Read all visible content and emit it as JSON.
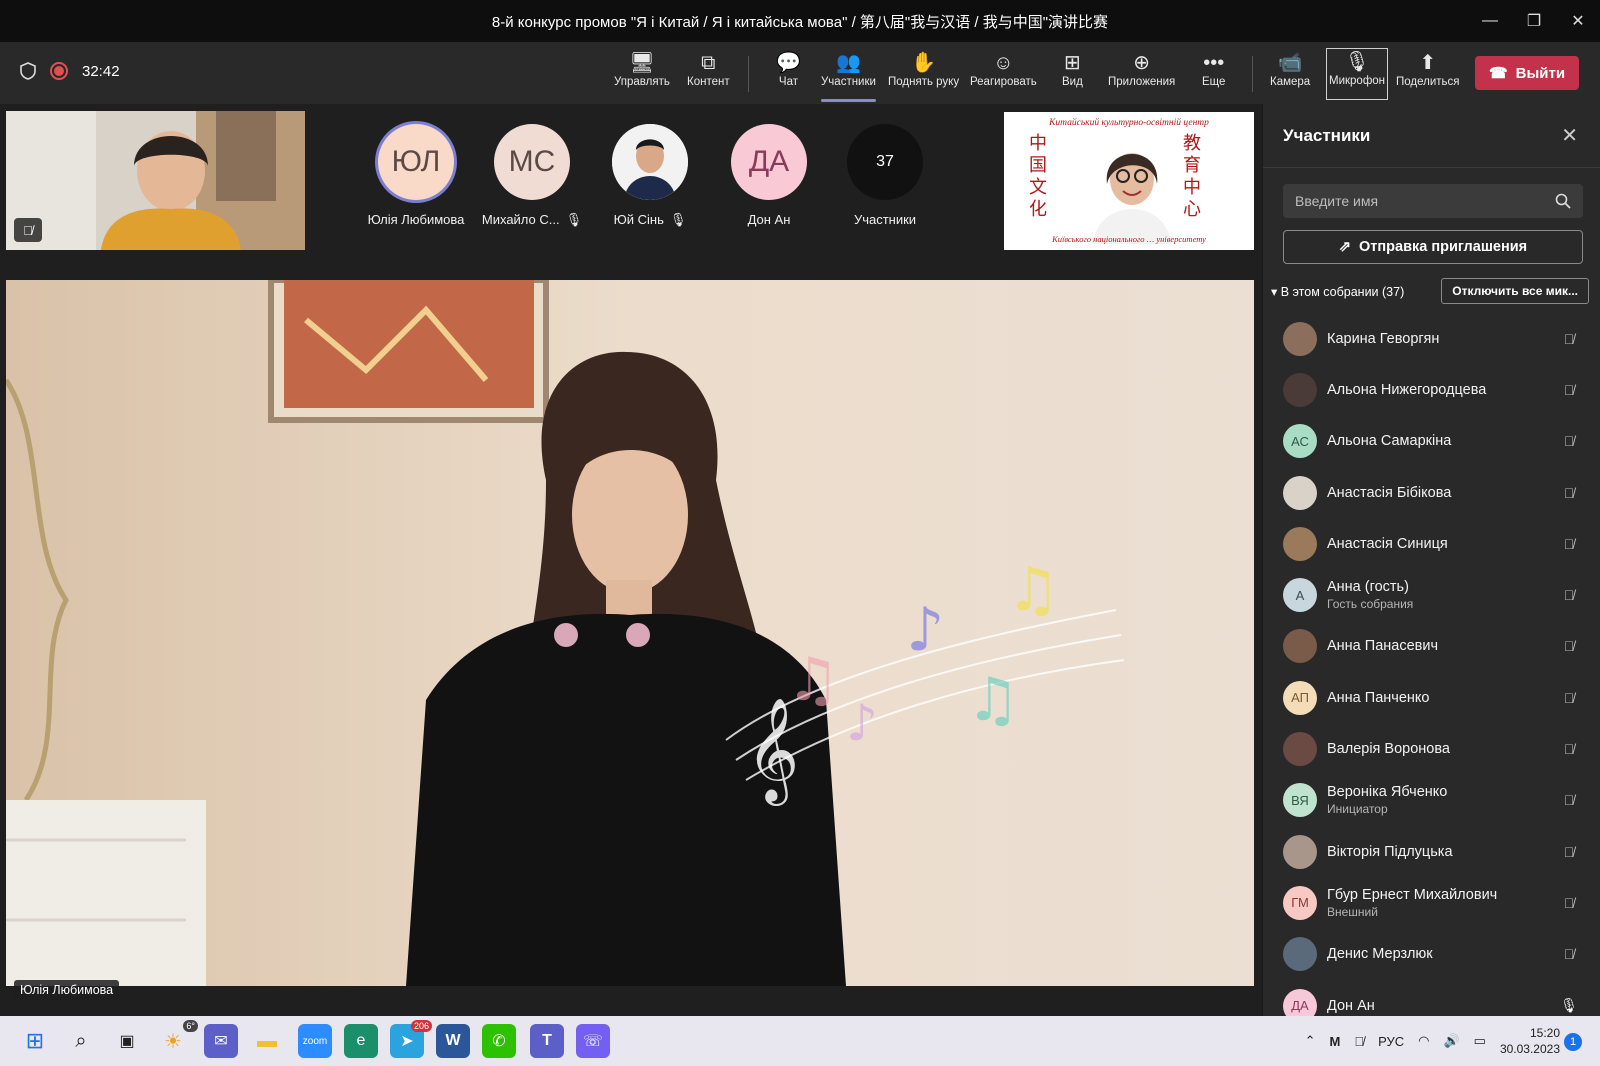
{
  "window": {
    "title": "8-й конкурс промов \"Я і Китай / Я і китайська мова\" / 第八届\"我与汉语 / 我与中国\"演讲比赛",
    "controls": [
      "—",
      "❐",
      "✕"
    ]
  },
  "toolbar": {
    "timer": "32:42",
    "buttons": [
      {
        "label": "Управлять",
        "icon": "🖥"
      },
      {
        "label": "Контент",
        "icon": "⧉"
      },
      {
        "label": "Чат",
        "icon": "💬"
      },
      {
        "label": "Участники",
        "icon": "👥"
      },
      {
        "label": "Поднять руку",
        "icon": "✋"
      },
      {
        "label": "Реагировать",
        "icon": "☺"
      },
      {
        "label": "Вид",
        "icon": "⊞"
      },
      {
        "label": "Приложения",
        "icon": "⊕"
      },
      {
        "label": "Еще",
        "icon": "•••"
      },
      {
        "label": "Камера",
        "icon": "📹"
      },
      {
        "label": "Микрофон",
        "icon": "🎙"
      },
      {
        "label": "Поделиться",
        "icon": "⬆"
      }
    ],
    "leave_label": "Выйти"
  },
  "stage": {
    "avatars": [
      {
        "initials": "ЮЛ",
        "name": "Юлія Любимова",
        "muted": false
      },
      {
        "initials": "МС",
        "name": "Михайло С...",
        "muted": true
      },
      {
        "initials": "",
        "name": "Юй Сінь",
        "muted": true
      },
      {
        "initials": "ДА",
        "name": "Дон Ан",
        "muted": false
      },
      {
        "initials": "37",
        "name": "Участники",
        "muted": false
      }
    ],
    "banner_header": "Китайський культурно-освітній центр",
    "banner_footer": "Київського національного … університету",
    "banner_left": [
      "中",
      "国",
      "文",
      "化"
    ],
    "banner_right": [
      "教",
      "育",
      "中",
      "心"
    ],
    "main_speaker_name": "Юлія Любимова"
  },
  "panel": {
    "title": "Участники",
    "search_placeholder": "Введите имя",
    "invite_label": "Отправка приглашения",
    "section_label": "В этом собрании (37)",
    "mute_all_label": "Отключить все мик...",
    "participants": [
      {
        "name": "Карина Геворгян",
        "initials": "",
        "color": "#8b6e5c",
        "sub": "",
        "mic": "muted"
      },
      {
        "name": "Альона Нижегородцева",
        "initials": "",
        "color": "#4a3a38",
        "sub": "",
        "mic": "muted"
      },
      {
        "name": "Альона Самаркіна",
        "initials": "АС",
        "color": "#a8dcc4",
        "sub": "",
        "mic": "muted"
      },
      {
        "name": "Анастасія Бібікова",
        "initials": "",
        "color": "#d8d2c8",
        "sub": "",
        "mic": "muted"
      },
      {
        "name": "Анастасія Синиця",
        "initials": "",
        "color": "#9a7a5a",
        "sub": "",
        "mic": "muted"
      },
      {
        "name": "Анна (гость)",
        "initials": "А",
        "color": "#c8d6de",
        "sub": "Гость собрания",
        "mic": "muted"
      },
      {
        "name": "Анна Панасевич",
        "initials": "",
        "color": "#7a5a48",
        "sub": "",
        "mic": "muted"
      },
      {
        "name": "Анна Панченко",
        "initials": "АП",
        "color": "#f5dcb8",
        "sub": "",
        "mic": "muted"
      },
      {
        "name": "Валерія Воронова",
        "initials": "",
        "color": "#6a4a42",
        "sub": "",
        "mic": "muted"
      },
      {
        "name": "Вероніка Ябченко",
        "initials": "ВЯ",
        "color": "#bfe3cf",
        "sub": "Инициатор",
        "mic": "muted"
      },
      {
        "name": "Вікторія Підлуцька",
        "initials": "",
        "color": "#a8968a",
        "sub": "",
        "mic": "muted"
      },
      {
        "name": "Гбур Ернест Михайлович",
        "initials": "ГМ",
        "color": "#f7c9c2",
        "sub": "Внешний",
        "mic": "muted"
      },
      {
        "name": "Денис Мерзлюк",
        "initials": "",
        "color": "#5a6a7a",
        "sub": "",
        "mic": "muted"
      },
      {
        "name": "Дон Ан",
        "initials": "ДА",
        "color": "#f7c9d8",
        "sub": "",
        "mic": "on"
      }
    ]
  },
  "taskbar": {
    "weather_badge": "6°",
    "telegram_badge": "206",
    "lang": "РУС",
    "time": "15:20",
    "date": "30.03.2023",
    "notifications": "1"
  },
  "colors": {
    "accent": "#8b8cc7",
    "leave": "#c4314b",
    "panel": "#292929"
  }
}
